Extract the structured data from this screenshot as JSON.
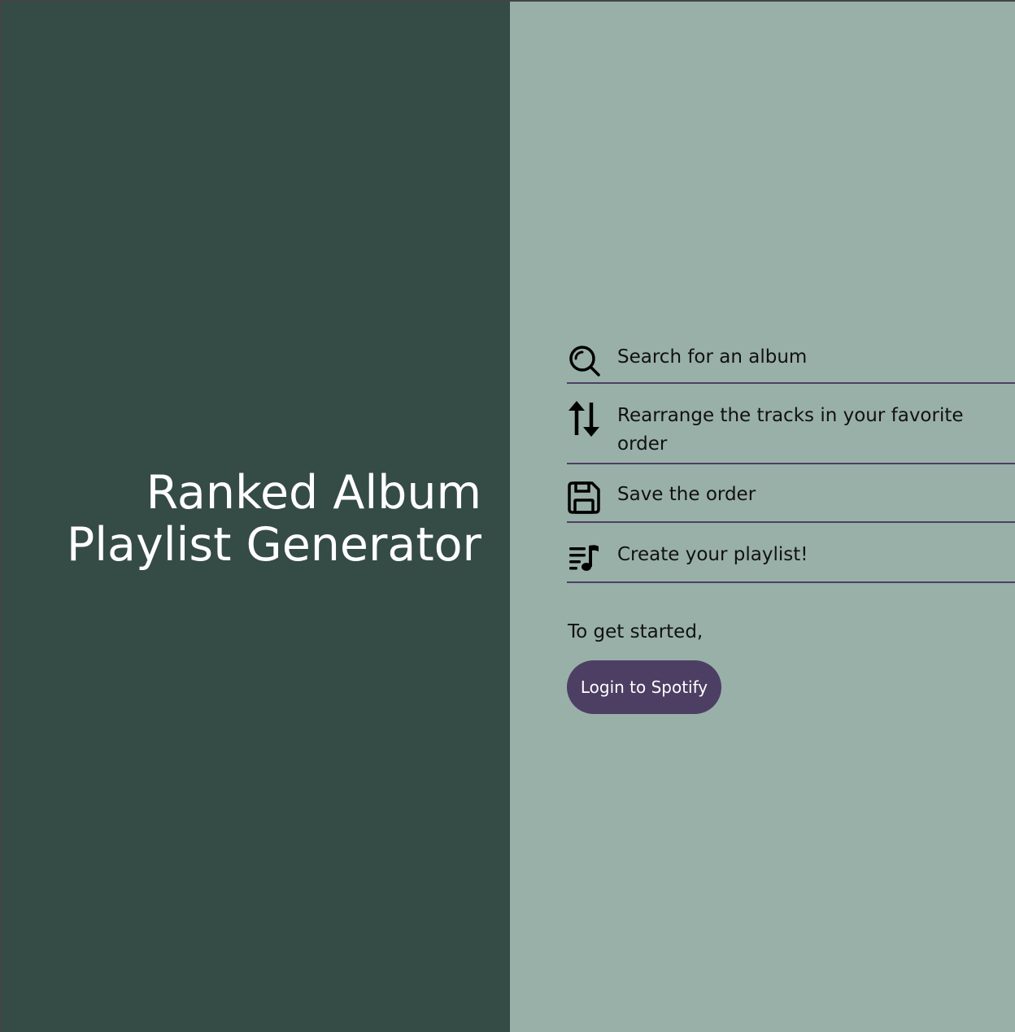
{
  "hero": {
    "title_line1": "Ranked Album",
    "title_line2": "Playlist Generator"
  },
  "steps": [
    {
      "icon": "search-icon",
      "label": "Search for an album"
    },
    {
      "icon": "sort-arrows-icon",
      "label": "Rearrange the tracks in your favorite order"
    },
    {
      "icon": "save-icon",
      "label": "Save the order"
    },
    {
      "icon": "playlist-music-icon",
      "label": "Create your playlist!"
    }
  ],
  "intro": {
    "text": "To get started,"
  },
  "login": {
    "label": "Login to Spotify"
  },
  "colors": {
    "left_panel": "#354b46",
    "right_panel": "#99b0a9",
    "accent": "#4d3f63",
    "title_text": "#ffffff"
  }
}
